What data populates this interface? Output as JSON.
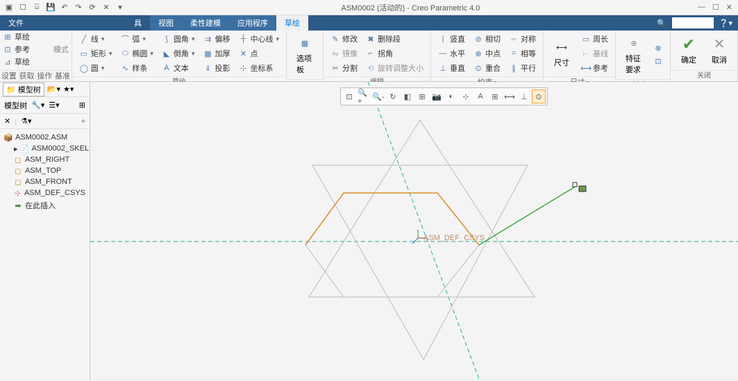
{
  "app": {
    "title": "ASM0002 (活动的) - Creo Parametric 4.0"
  },
  "tabs": {
    "file": "文件",
    "tool": "具",
    "view": "视图",
    "flex": "柔性建模",
    "app": "应用程序",
    "sketch": "草绘"
  },
  "left_quick": {
    "item1": "草绘",
    "item2": "参考",
    "item3": "草绘",
    "mode": "模式"
  },
  "ribbon": {
    "group_setup": "设置",
    "group_getdata": "获取数据",
    "group_ops": "操作",
    "group_datum": "基准",
    "group_sketch": "草绘",
    "group_edit": "编辑",
    "group_constrain": "约束",
    "group_dim": "尺寸",
    "group_inspect": "检查",
    "group_close": "关闭",
    "line": "线",
    "arc": "弧",
    "fillet": "圆角",
    "offset": "偏移",
    "centerline": "中心线",
    "rect": "矩形",
    "ellipse": "椭圆",
    "chamfer": "倒角",
    "thicken": "加厚",
    "point": "点",
    "circle": "圆",
    "spline": "样条",
    "text": "文本",
    "project": "投影",
    "csys": "坐标系",
    "palette": "选项板",
    "modify": "修改",
    "delete_seg": "删除段",
    "mirror": "镜像",
    "corner": "拐角",
    "divide": "分割",
    "rotate_resize": "旋转调整大小",
    "vertical": "竖直",
    "tangent": "相切",
    "symmetric": "对称",
    "horizontal": "水平",
    "midpoint": "中点",
    "equal": "相等",
    "perpendicular": "垂直",
    "coincident": "重合",
    "parallel": "平行",
    "dimension": "尺寸",
    "perimeter": "周长",
    "baseline": "基线",
    "reference": "参考",
    "feature_req": "特征要求",
    "ok": "确定",
    "cancel": "取消"
  },
  "leftpanel": {
    "tab_tree": "模型树",
    "toolbar_label": "模型树"
  },
  "tree": {
    "root": "ASM0002.ASM",
    "skel": "ASM0002_SKEL.PRT",
    "right": "ASM_RIGHT",
    "top": "ASM_TOP",
    "front": "ASM_FRONT",
    "csys": "ASM_DEF_CSYS",
    "insert": "在此插入"
  },
  "canvas": {
    "csys_label": "ASM_DEF_CSYS"
  }
}
